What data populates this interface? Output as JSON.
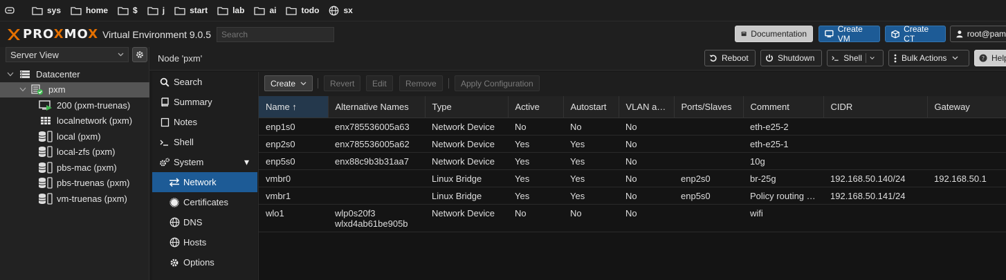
{
  "bookmarks": [
    {
      "label": "",
      "icon": "cylinder-icon"
    },
    {
      "label": "sys",
      "icon": "folder-icon"
    },
    {
      "label": "home",
      "icon": "folder-icon"
    },
    {
      "label": "$",
      "icon": "folder-icon"
    },
    {
      "label": "j",
      "icon": "folder-icon"
    },
    {
      "label": "start",
      "icon": "folder-icon"
    },
    {
      "label": "lab",
      "icon": "folder-icon"
    },
    {
      "label": "ai",
      "icon": "folder-icon"
    },
    {
      "label": "todo",
      "icon": "folder-icon"
    },
    {
      "label": "sx",
      "icon": "globe-icon"
    }
  ],
  "header": {
    "logo_pre": "PRO",
    "logo_x": "X",
    "logo_mo": "MO",
    "logo_x2": "X",
    "ve_label": "Virtual Environment 9.0.5",
    "search_placeholder": "Search",
    "doc_label": "Documentation",
    "create_vm_label": "Create VM",
    "create_ct_label": "Create CT",
    "user_label": "root@pam"
  },
  "sidebar": {
    "view_label": "Server View",
    "tree": [
      {
        "label": "Datacenter",
        "icon": "datacenter-icon",
        "indent": 0
      },
      {
        "label": "pxm",
        "icon": "node-online-icon",
        "indent": 1,
        "selected": true
      },
      {
        "label": "200 (pxm-truenas)",
        "icon": "vm-running-icon",
        "indent": 2
      },
      {
        "label": "localnetwork (pxm)",
        "icon": "sdn-zone-icon",
        "indent": 2
      },
      {
        "label": "local (pxm)",
        "icon": "storage-icon",
        "indent": 2
      },
      {
        "label": "local-zfs (pxm)",
        "icon": "storage-icon",
        "indent": 2
      },
      {
        "label": "pbs-mac (pxm)",
        "icon": "storage-icon",
        "indent": 2
      },
      {
        "label": "pbs-truenas (pxm)",
        "icon": "storage-icon",
        "indent": 2
      },
      {
        "label": "vm-truenas (pxm)",
        "icon": "storage-icon",
        "indent": 2
      }
    ]
  },
  "nodebar": {
    "title": "Node 'pxm'",
    "reboot_label": "Reboot",
    "shutdown_label": "Shutdown",
    "shell_label": "Shell",
    "bulk_label": "Bulk Actions",
    "help_label": "Help"
  },
  "nav": [
    {
      "label": "Search",
      "icon": "search-icon",
      "sub": false
    },
    {
      "label": "Summary",
      "icon": "book-icon",
      "sub": false
    },
    {
      "label": "Notes",
      "icon": "notes-icon",
      "sub": false
    },
    {
      "label": "Shell",
      "icon": "terminal-icon",
      "sub": false
    },
    {
      "label": "System",
      "icon": "cogs-icon",
      "sub": false,
      "expand": "▾"
    },
    {
      "label": "Network",
      "icon": "exchange-icon",
      "sub": true,
      "active": true
    },
    {
      "label": "Certificates",
      "icon": "certificate-icon",
      "sub": true
    },
    {
      "label": "DNS",
      "icon": "globe-icon",
      "sub": true
    },
    {
      "label": "Hosts",
      "icon": "globe-icon",
      "sub": true
    },
    {
      "label": "Options",
      "icon": "gear-icon",
      "sub": true
    }
  ],
  "toolbar": {
    "create_label": "Create",
    "revert_label": "Revert",
    "edit_label": "Edit",
    "remove_label": "Remove",
    "apply_label": "Apply Configuration"
  },
  "table": {
    "columns": [
      "Name ↑",
      "Alternative Names",
      "Type",
      "Active",
      "Autostart",
      "VLAN a…",
      "Ports/Slaves",
      "Comment",
      "CIDR",
      "Gateway"
    ],
    "rows": [
      [
        "enp1s0",
        "enx785536005a63",
        "Network Device",
        "No",
        "No",
        "No",
        "",
        "eth-e25-2",
        "",
        ""
      ],
      [
        "enp2s0",
        "enx785536005a62",
        "Network Device",
        "Yes",
        "Yes",
        "No",
        "",
        "eth-e25-1",
        "",
        ""
      ],
      [
        "enp5s0",
        "enx88c9b3b31aa7",
        "Network Device",
        "Yes",
        "Yes",
        "No",
        "",
        "10g",
        "",
        ""
      ],
      [
        "vmbr0",
        "",
        "Linux Bridge",
        "Yes",
        "Yes",
        "No",
        "enp2s0",
        "br-25g",
        "192.168.50.140/24",
        "192.168.50.1"
      ],
      [
        "vmbr1",
        "",
        "Linux Bridge",
        "Yes",
        "Yes",
        "No",
        "enp5s0",
        "Policy routing …",
        "192.168.50.141/24",
        ""
      ],
      [
        "wlo1",
        "wlp0s20f3\nwlxd4ab61be905b",
        "Network Device",
        "No",
        "No",
        "No",
        "",
        "wifi",
        "",
        ""
      ]
    ]
  },
  "colors": {
    "accent_orange": "#e57000",
    "primary_blue": "#1d5b96",
    "online_green": "#3fb950"
  }
}
